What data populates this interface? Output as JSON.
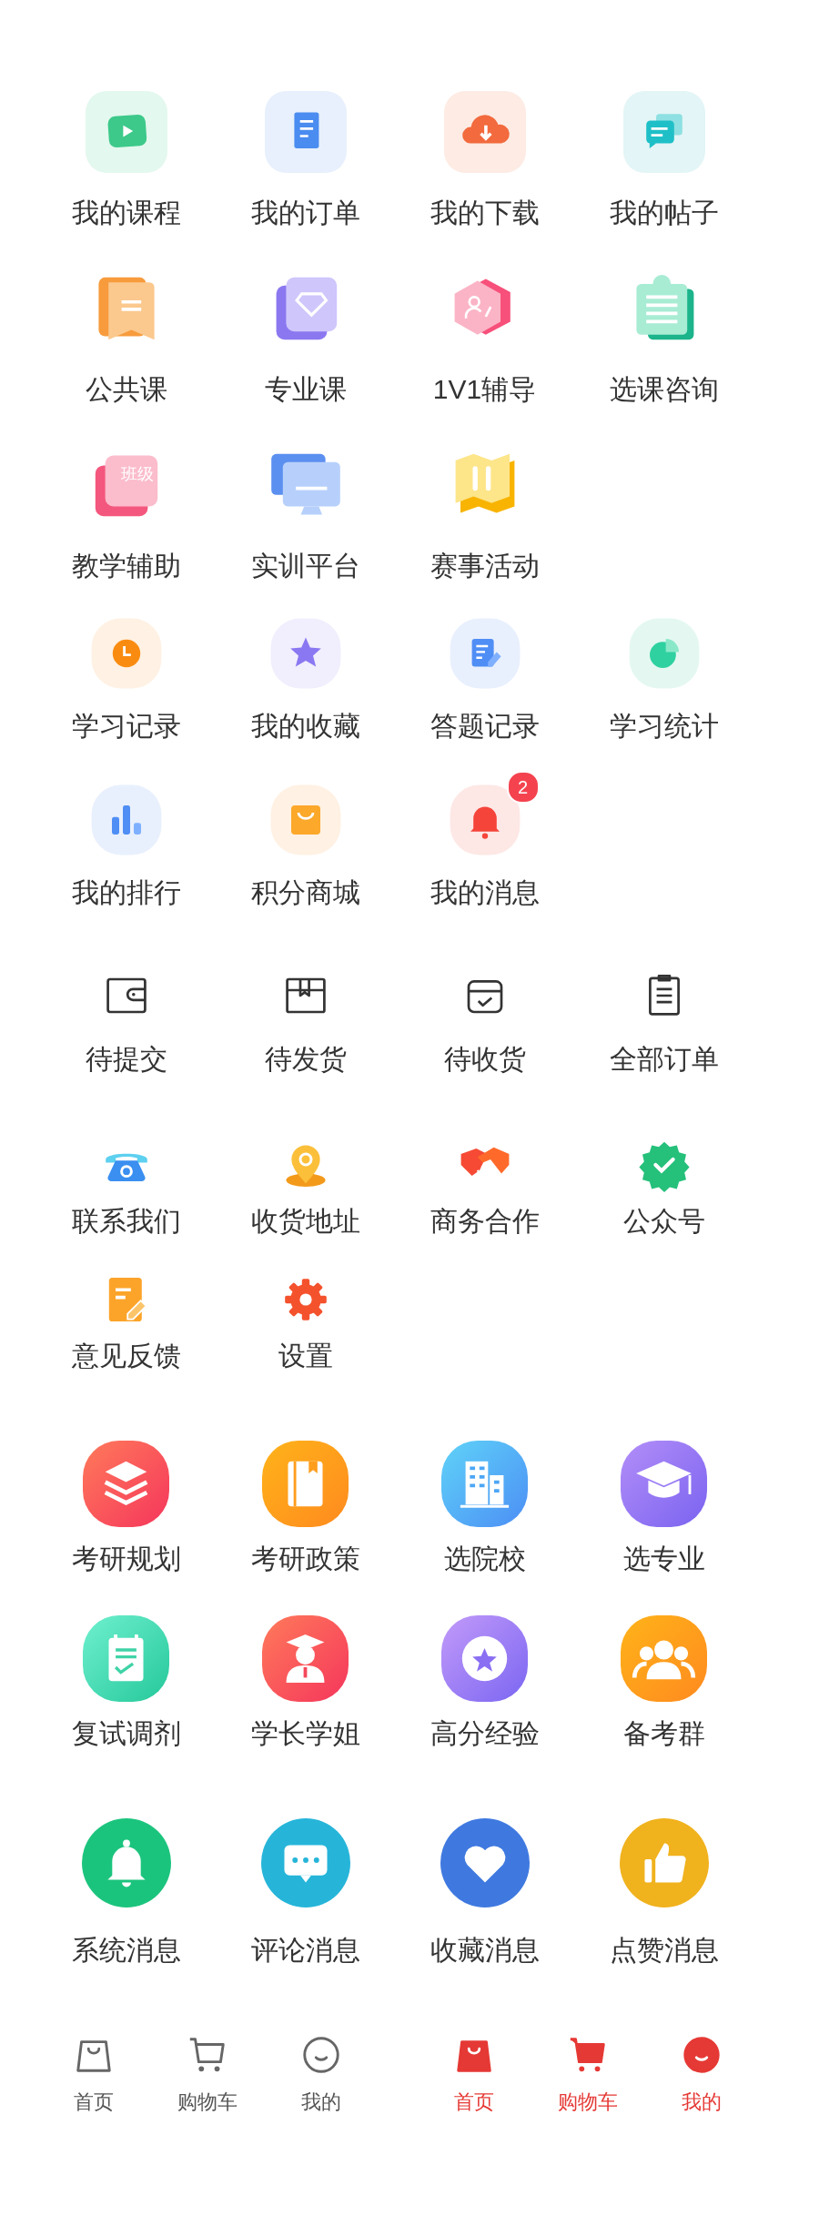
{
  "sections": [
    {
      "items": [
        {
          "label": "我的课程"
        },
        {
          "label": "我的订单"
        },
        {
          "label": "我的下载"
        },
        {
          "label": "我的帖子"
        },
        {
          "label": "公共课"
        },
        {
          "label": "专业课"
        },
        {
          "label": "1V1辅导"
        },
        {
          "label": "选课咨询"
        },
        {
          "label": "教学辅助",
          "icon_text": "班级"
        },
        {
          "label": "实训平台"
        },
        {
          "label": "赛事活动"
        }
      ]
    },
    {
      "items": [
        {
          "label": "学习记录"
        },
        {
          "label": "我的收藏"
        },
        {
          "label": "答题记录"
        },
        {
          "label": "学习统计"
        },
        {
          "label": "我的排行"
        },
        {
          "label": "积分商城"
        },
        {
          "label": "我的消息",
          "badge": "2"
        }
      ]
    },
    {
      "items": [
        {
          "label": "待提交"
        },
        {
          "label": "待发货"
        },
        {
          "label": "待收货"
        },
        {
          "label": "全部订单"
        }
      ]
    },
    {
      "items": [
        {
          "label": "联系我们"
        },
        {
          "label": "收货地址"
        },
        {
          "label": "商务合作"
        },
        {
          "label": "公众号"
        },
        {
          "label": "意见反馈"
        },
        {
          "label": "设置"
        }
      ]
    },
    {
      "items": [
        {
          "label": "考研规划"
        },
        {
          "label": "考研政策"
        },
        {
          "label": "选院校"
        },
        {
          "label": "选专业"
        },
        {
          "label": "复试调剂"
        },
        {
          "label": "学长学姐"
        },
        {
          "label": "高分经验"
        },
        {
          "label": "备考群"
        }
      ]
    },
    {
      "items": [
        {
          "label": "系统消息"
        },
        {
          "label": "评论消息"
        },
        {
          "label": "收藏消息"
        },
        {
          "label": "点赞消息"
        }
      ]
    }
  ],
  "tab_bars": [
    {
      "tabs": [
        {
          "label": "首页",
          "selected": false
        },
        {
          "label": "购物车",
          "selected": false
        },
        {
          "label": "我的",
          "selected": false
        }
      ]
    },
    {
      "tabs": [
        {
          "label": "首页",
          "selected": true
        },
        {
          "label": "购物车",
          "selected": true
        },
        {
          "label": "我的",
          "selected": true
        }
      ]
    }
  ]
}
